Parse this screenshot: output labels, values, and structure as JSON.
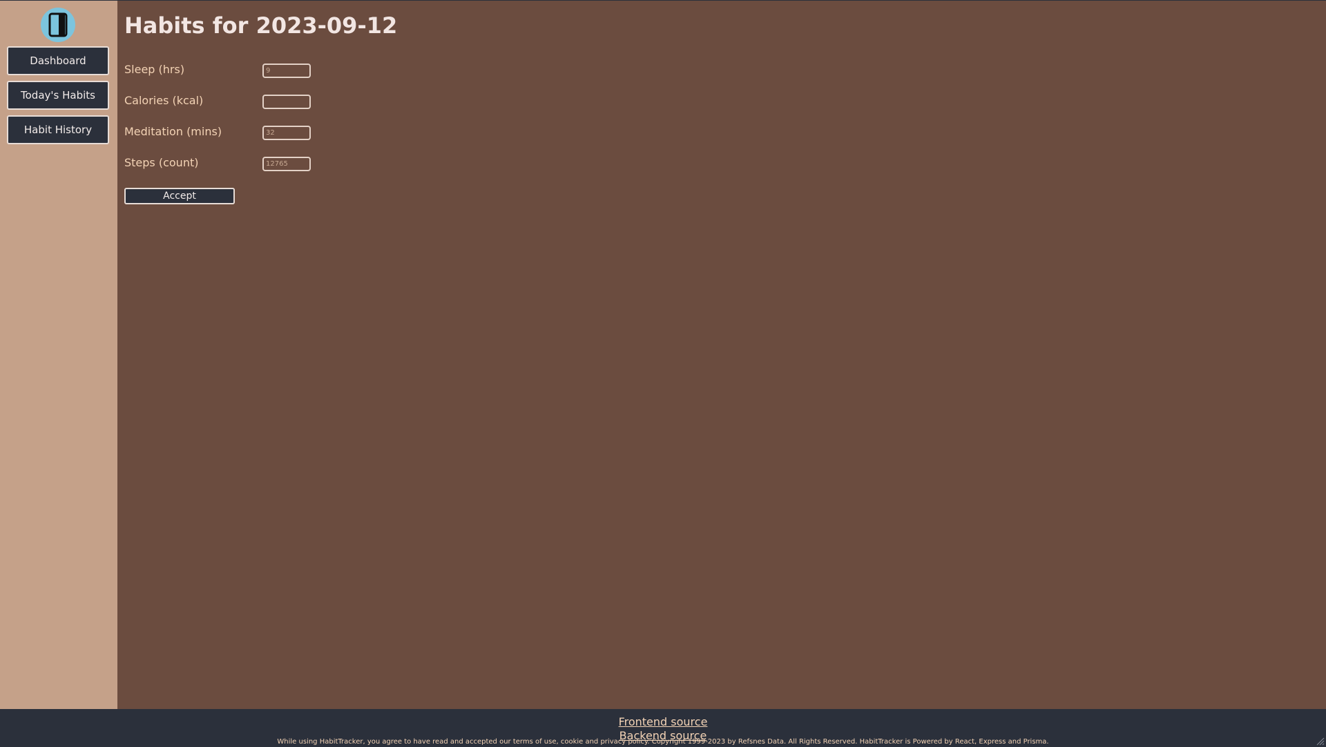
{
  "sidebar": {
    "logo_icon": "book-panel-icon",
    "items": [
      {
        "label": "Dashboard"
      },
      {
        "label": "Today's Habits"
      },
      {
        "label": "Habit History"
      }
    ]
  },
  "main": {
    "title": "Habits for 2023-09-12",
    "fields": [
      {
        "label": "Sleep (hrs)",
        "value": "",
        "placeholder": "9"
      },
      {
        "label": "Calories (kcal)",
        "value": "",
        "placeholder": ""
      },
      {
        "label": "Meditation (mins)",
        "value": "",
        "placeholder": "32"
      },
      {
        "label": "Steps (count)",
        "value": "",
        "placeholder": "12765"
      }
    ],
    "accept_label": "Accept"
  },
  "footer": {
    "frontend_link": "Frontend source",
    "backend_link": "Backend source",
    "legal": "While using HabitTracker, you agree to have read and accepted our terms of use, cookie and privacy policy. Copyright 1999-2023 by Refsnes Data. All Rights Reserved. HabitTracker is Powered by React, Express and Prisma."
  },
  "colors": {
    "main_bg": "#6b4c3f",
    "sidebar_bg": "#c5a189",
    "button_bg": "#2b303b",
    "accent_text": "#f3d3b5",
    "logo_bg": "#7cc4dd"
  }
}
